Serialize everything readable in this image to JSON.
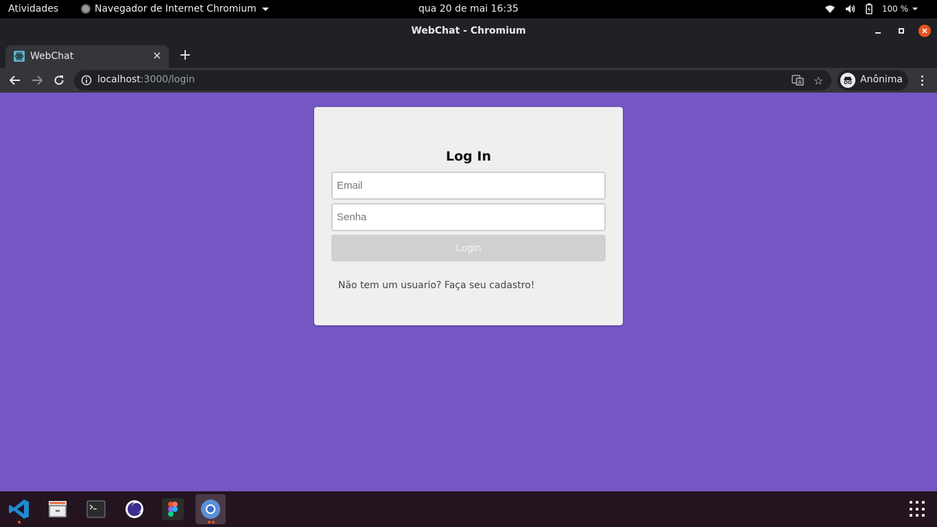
{
  "topbar": {
    "activities": "Atividades",
    "app_name": "Navegador de Internet Chromium",
    "clock": "qua 20 de mai  16:35",
    "battery": "100 %"
  },
  "window": {
    "title": "WebChat - Chromium"
  },
  "tab": {
    "title": "WebChat",
    "close": "×",
    "new_tab": "+"
  },
  "toolbar": {
    "url_host": "localhost",
    "url_path": ":3000/login",
    "profile_label": "Anônima"
  },
  "login": {
    "heading": "Log In",
    "email_placeholder": "Email",
    "password_placeholder": "Senha",
    "button_label": "Login",
    "signup_text": "Não tem um usuario? Faça seu cadastro!"
  },
  "colors": {
    "page_background": "#7457c2",
    "card_background": "#efefef",
    "button_disabled": "#d0d0d0",
    "ubuntu_orange": "#e95420"
  },
  "dock": {
    "apps": [
      "vscode-icon",
      "files-icon",
      "terminal-icon",
      "eclipse-icon",
      "figma-icon",
      "chromium-icon"
    ]
  }
}
